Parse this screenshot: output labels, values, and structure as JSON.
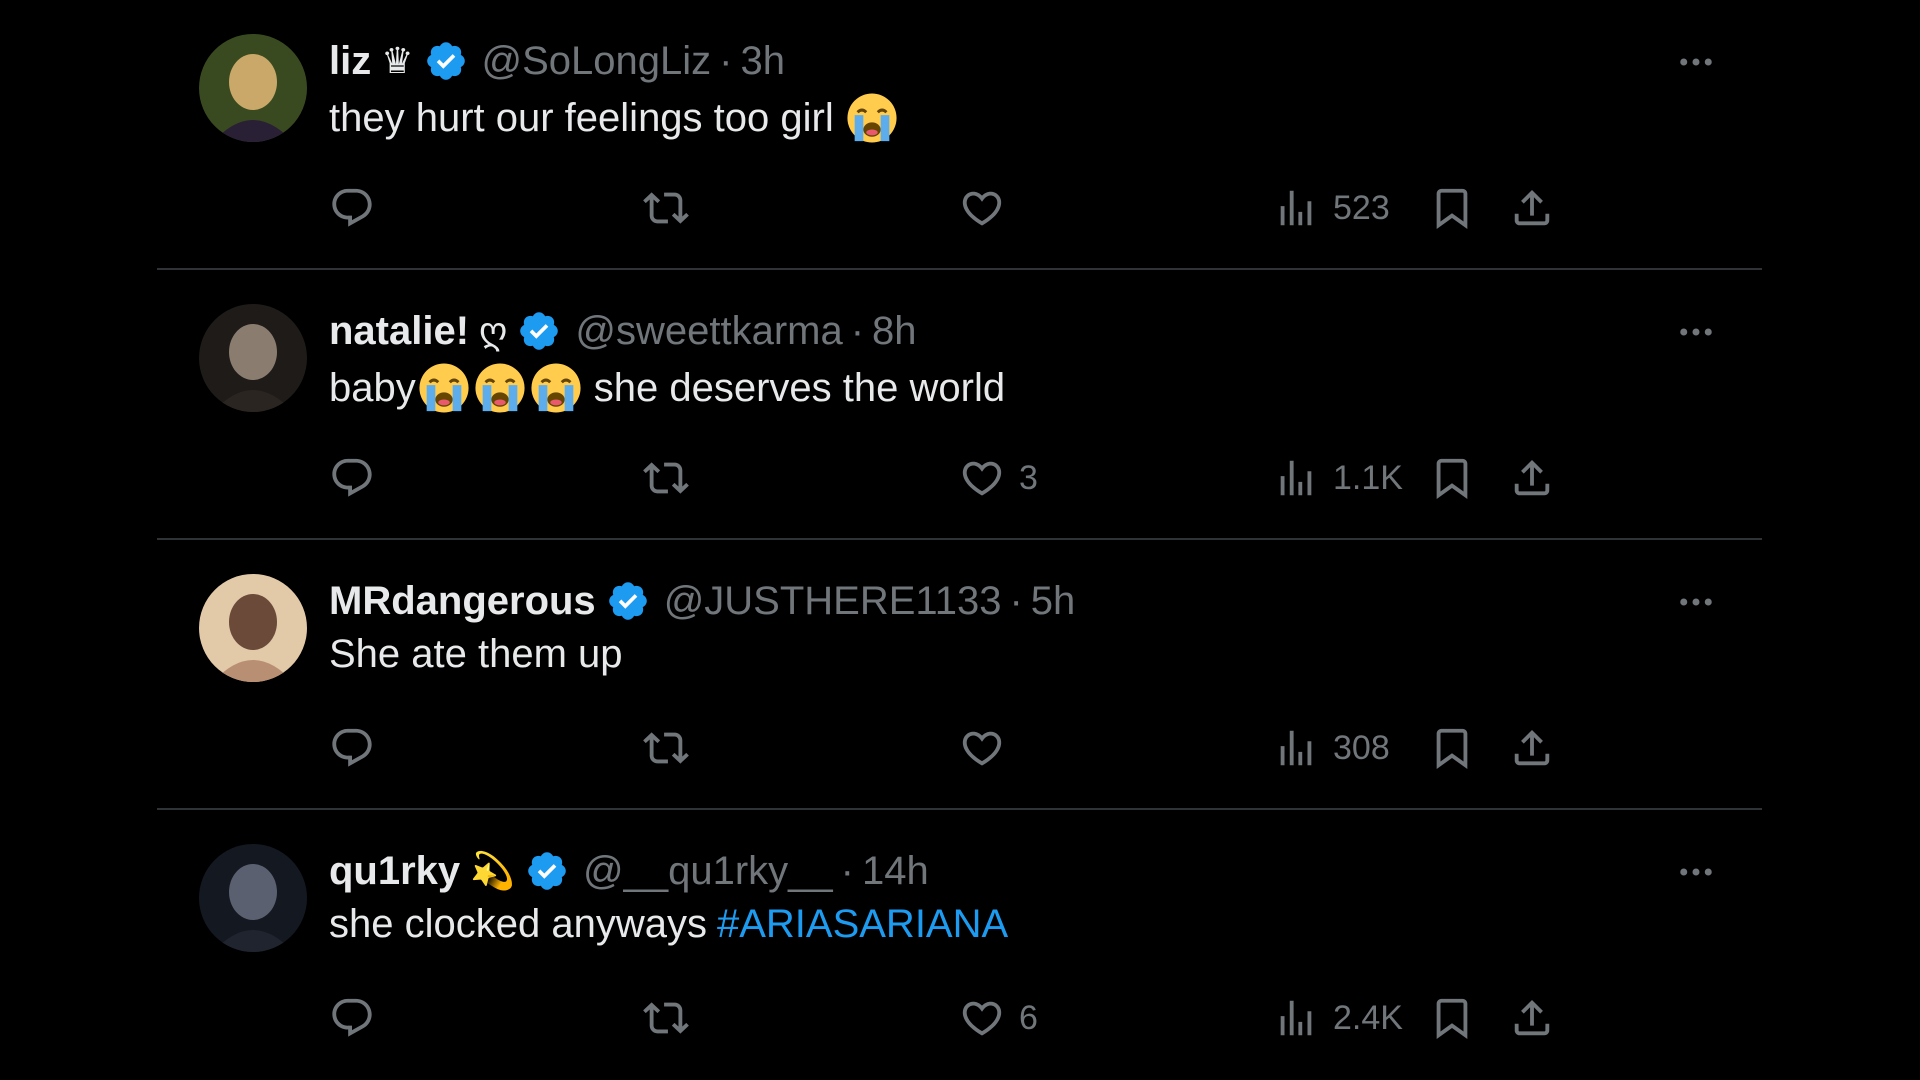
{
  "tweets": [
    {
      "name": "liz",
      "name_extra": "♛",
      "handle": "@SoLongLiz",
      "separator": "·",
      "time": "3h",
      "text": "they hurt our feelings too girl",
      "emoji_after": 1,
      "emoji_inline": 0,
      "text_after": "",
      "hashtag": "",
      "replies": "",
      "retweets": "",
      "likes": "",
      "views": "523",
      "avatar_colors": [
        "#3a4a20",
        "#c9a86a",
        "#2a2035"
      ]
    },
    {
      "name": "natalie!",
      "name_extra": "ღ",
      "handle": "@sweettkarma",
      "separator": "·",
      "time": "8h",
      "text": "baby",
      "emoji_after": 0,
      "emoji_inline": 3,
      "text_after": "she deserves the world",
      "hashtag": "",
      "replies": "",
      "retweets": "",
      "likes": "3",
      "views": "1.1K",
      "avatar_colors": [
        "#1e1b18",
        "#8a7d70",
        "#2b2522"
      ]
    },
    {
      "name": "MRdangerous",
      "name_extra": "",
      "handle": "@JUSTHERE1133",
      "separator": "·",
      "time": "5h",
      "text": "She ate them up",
      "emoji_after": 0,
      "emoji_inline": 0,
      "text_after": "",
      "hashtag": "",
      "replies": "",
      "retweets": "",
      "likes": "",
      "views": "308",
      "avatar_colors": [
        "#e2c9a8",
        "#6b4a3a",
        "#b88f72"
      ]
    },
    {
      "name": "qu1rky",
      "name_extra": "💫",
      "handle": "@__qu1rky__",
      "separator": "·",
      "time": "14h",
      "text": "she clocked anyways",
      "emoji_after": 0,
      "emoji_inline": 0,
      "text_after": "",
      "hashtag": "#ARIASARIANA",
      "replies": "",
      "retweets": "",
      "likes": "6",
      "views": "2.4K",
      "avatar_colors": [
        "#141820",
        "#5a6070",
        "#20242e"
      ]
    }
  ],
  "colors": {
    "background": "#000000",
    "text": "#e7e9ea",
    "muted": "#71767b",
    "verified": "#1d9bf0",
    "hashtag": "#1d9bf0",
    "divider": "#2f3336"
  },
  "icons": {
    "reply": "reply-icon",
    "retweet": "retweet-icon",
    "like": "heart-icon",
    "views": "views-icon",
    "bookmark": "bookmark-icon",
    "share": "share-icon",
    "more": "more-icon",
    "verified": "verified-badge-icon",
    "emoji": "crying-face-emoji"
  }
}
